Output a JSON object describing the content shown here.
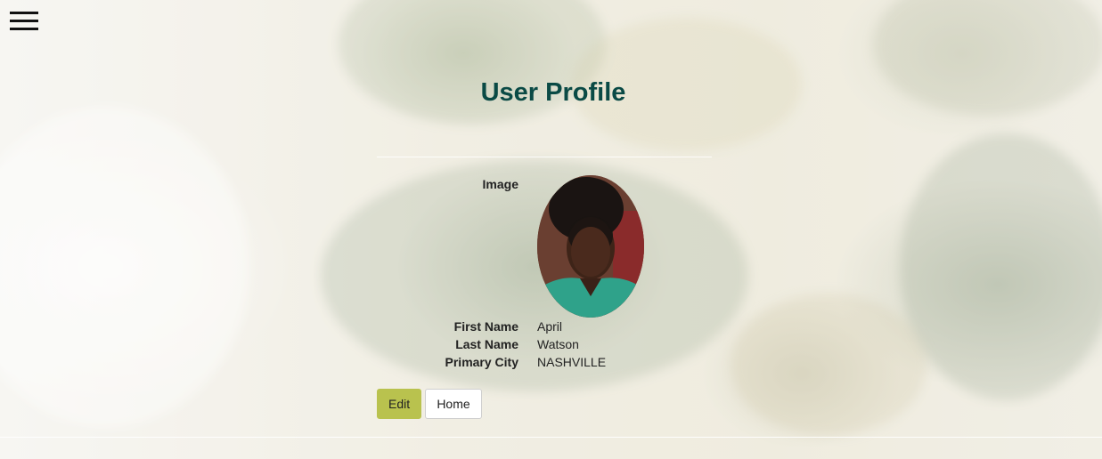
{
  "header": {
    "menu_icon": "hamburger-menu-icon"
  },
  "page": {
    "title": "User Profile"
  },
  "profile": {
    "image_label": "Image",
    "avatar": "user-photo",
    "fields": [
      {
        "label": "First Name",
        "value": "April"
      },
      {
        "label": "Last Name",
        "value": "Watson"
      },
      {
        "label": "Primary City",
        "value": "NASHVILLE"
      }
    ]
  },
  "actions": {
    "edit_label": "Edit",
    "home_label": "Home"
  },
  "colors": {
    "title": "#0a4a45",
    "edit_button": "#b9c24e",
    "home_button": "#ffffff"
  }
}
